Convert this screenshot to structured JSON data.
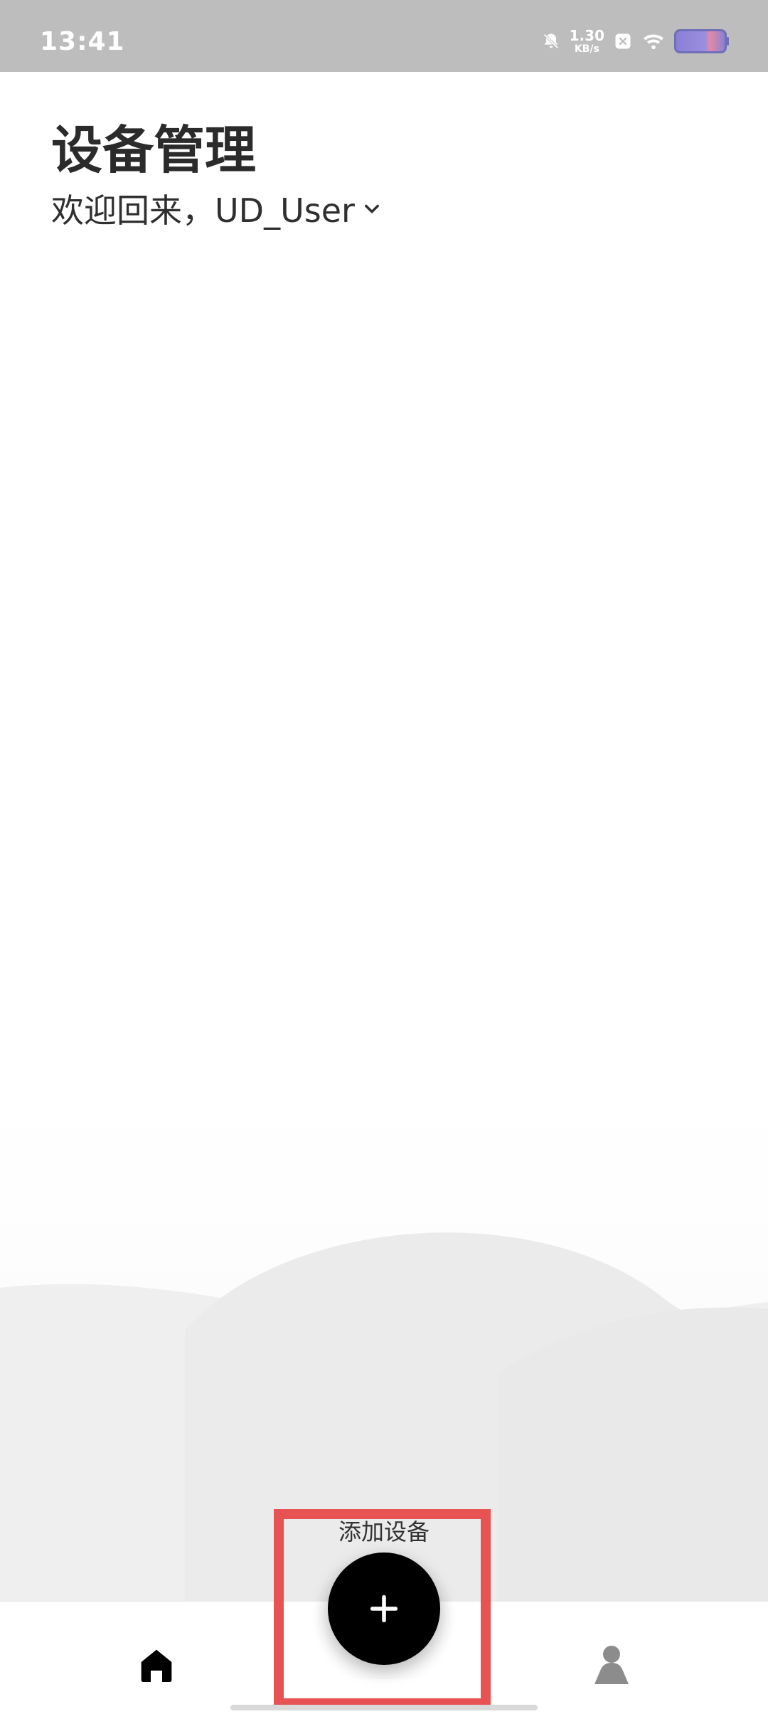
{
  "status_bar": {
    "time": "13:41",
    "net_speed_value": "1.30",
    "net_speed_unit": "KB/s",
    "icons": [
      "bell-off-icon",
      "dnd-icon",
      "wifi-icon",
      "battery-icon"
    ]
  },
  "header": {
    "title": "设备管理",
    "welcome": "欢迎回来，UD_User"
  },
  "actions": {
    "add_device_label": "添加设备"
  },
  "bottom_nav": {
    "items": [
      {
        "name": "home",
        "icon": "home-icon"
      },
      {
        "name": "profile",
        "icon": "profile-icon"
      }
    ]
  },
  "colors": {
    "accent_red": "#E75252",
    "fab_black": "#000000",
    "title_text": "#2B2B2B",
    "status_bar_gray": "#BDBDBD"
  }
}
